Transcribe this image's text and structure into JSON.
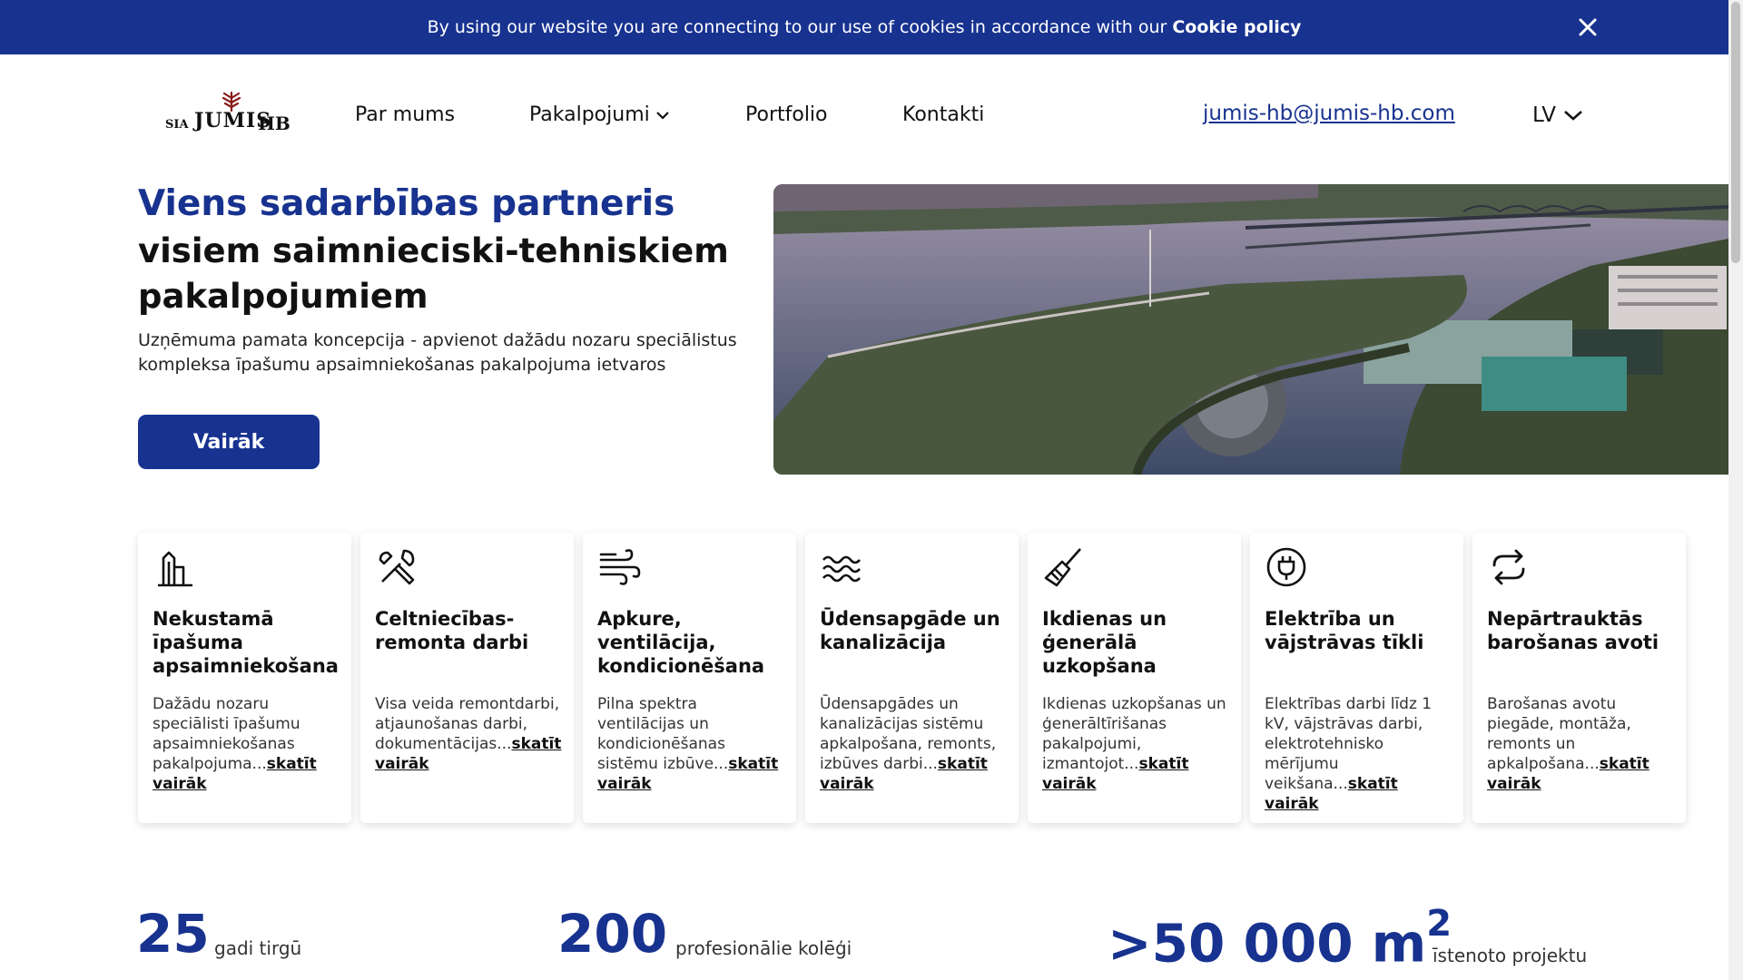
{
  "cookie": {
    "text": "By using our website you are connecting to our use of cookies in accordance with our",
    "policy_link": "Cookie policy"
  },
  "header": {
    "logo": {
      "prefix": "SIA",
      "name": "JUMIS",
      "suffix": "HB"
    },
    "nav": [
      {
        "label": "Par mums"
      },
      {
        "label": "Pakalpojumi",
        "has_dropdown": true
      },
      {
        "label": "Portfolio"
      },
      {
        "label": "Kontakti"
      }
    ],
    "email": "jumis-hb@jumis-hb.com",
    "language": "LV"
  },
  "hero": {
    "title_accent": "Viens sadarbības partneris",
    "title_rest": "visiem saimnieciski-tehniskiem pakalpojumiem",
    "description": "Uzņēmuma pamata koncepcija - apvienot dažādu nozaru speciālistus kompleksa īpašumu apsaimniekošanas pakalpojuma ietvaros",
    "button": "Vairāk"
  },
  "services": [
    {
      "icon": "building-icon",
      "title": "Nekustamā īpašuma apsaimniekošana",
      "desc": "Dažādu nozaru speciālisti īpašumu apsaimniekošanas pakalpojuma...",
      "more": "skatīt vairāk"
    },
    {
      "icon": "tools-icon",
      "title": "Celtniecības-remonta darbi",
      "desc": "Visa veida remontdarbi, atjaunošanas darbi, dokumentācijas...",
      "more": "skatīt vairāk"
    },
    {
      "icon": "wind-icon",
      "title": "Apkure, ventilācija, kondicionēšana",
      "desc": "Pilna spektra ventilācijas un kondicionēšanas sistēmu izbūve...",
      "more": "skatīt vairāk"
    },
    {
      "icon": "waves-icon",
      "title": "Ūdensapgāde un kanalizācija",
      "desc": "Ūdensapgādes un kanalizācijas sistēmu apkalpošana, remonts, izbūves darbi...",
      "more": "skatīt vairāk"
    },
    {
      "icon": "broom-icon",
      "title": "Ikdienas un ģenerālā uzkopšana",
      "desc": "Ikdienas uzkopšanas un ģenerāltīrišanas pakalpojumi, izmantojot...",
      "more": "skatīt vairāk"
    },
    {
      "icon": "plug-icon",
      "title": "Elektrība un vājstrāvas tīkli",
      "desc": "Elektrības darbi līdz 1 kV, vājstrāvas darbi, elektrotehnisko mērījumu veikšana...",
      "more": "skatīt vairāk"
    },
    {
      "icon": "cycle-icon",
      "title": "Nepārtrauktās barošanas avoti",
      "desc": "Barošanas avotu piegāde, montāža, remonts un apkalpošana...",
      "more": "skatīt vairāk"
    }
  ],
  "stats": [
    {
      "value": "25",
      "label": "gadi tirgū"
    },
    {
      "value": "200",
      "label": "profesionālie kolēģi"
    },
    {
      "value": ">50 000 m",
      "superscript": "2",
      "label": "īstenoto projektu"
    }
  ],
  "colors": {
    "brand": "#17328f",
    "text": "#111111"
  }
}
